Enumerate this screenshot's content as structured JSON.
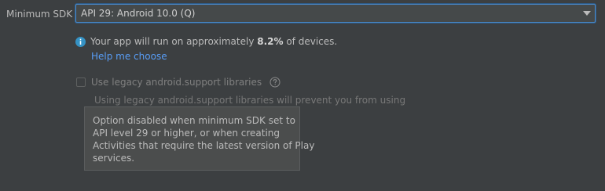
{
  "minimum_sdk": {
    "label": "Minimum SDK",
    "selected_value": "API 29: Android 10.0 (Q)"
  },
  "info": {
    "icon": "info-icon",
    "text_prefix": "Your app will run on approximately ",
    "percentage": "8.2%",
    "text_suffix": " of devices.",
    "help_link": "Help me choose"
  },
  "legacy_support": {
    "checked": false,
    "enabled": false,
    "label": "Use legacy android.support libraries",
    "help_icon": "question-circle-icon",
    "description": "Using legacy android.support libraries will prevent you from using"
  },
  "tooltip": {
    "lines": [
      "Option disabled when minimum SDK set to",
      "API level 29 or higher, or when creating",
      "Activities that require the latest version of Play",
      "services."
    ]
  },
  "colors": {
    "background": "#3c3f41",
    "accent_border": "#4a88c7",
    "link": "#589df6",
    "info_icon": "#3592c4"
  }
}
